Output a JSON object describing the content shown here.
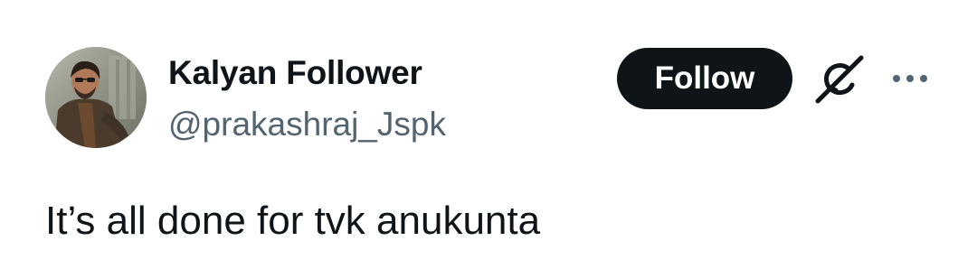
{
  "author": {
    "display_name": "Kalyan Follower",
    "handle": "@prakashraj_Jspk",
    "avatar_icon": "user-avatar-photo"
  },
  "actions": {
    "follow_label": "Follow",
    "grok_icon": "grok-slash-icon",
    "more_icon": "more-dots-icon"
  },
  "tweet": {
    "text": "It’s all done for tvk anukunta"
  },
  "colors": {
    "text_primary": "#0f1419",
    "text_secondary": "#536471",
    "follow_bg": "#0f1419",
    "follow_text": "#ffffff",
    "background": "#ffffff"
  }
}
